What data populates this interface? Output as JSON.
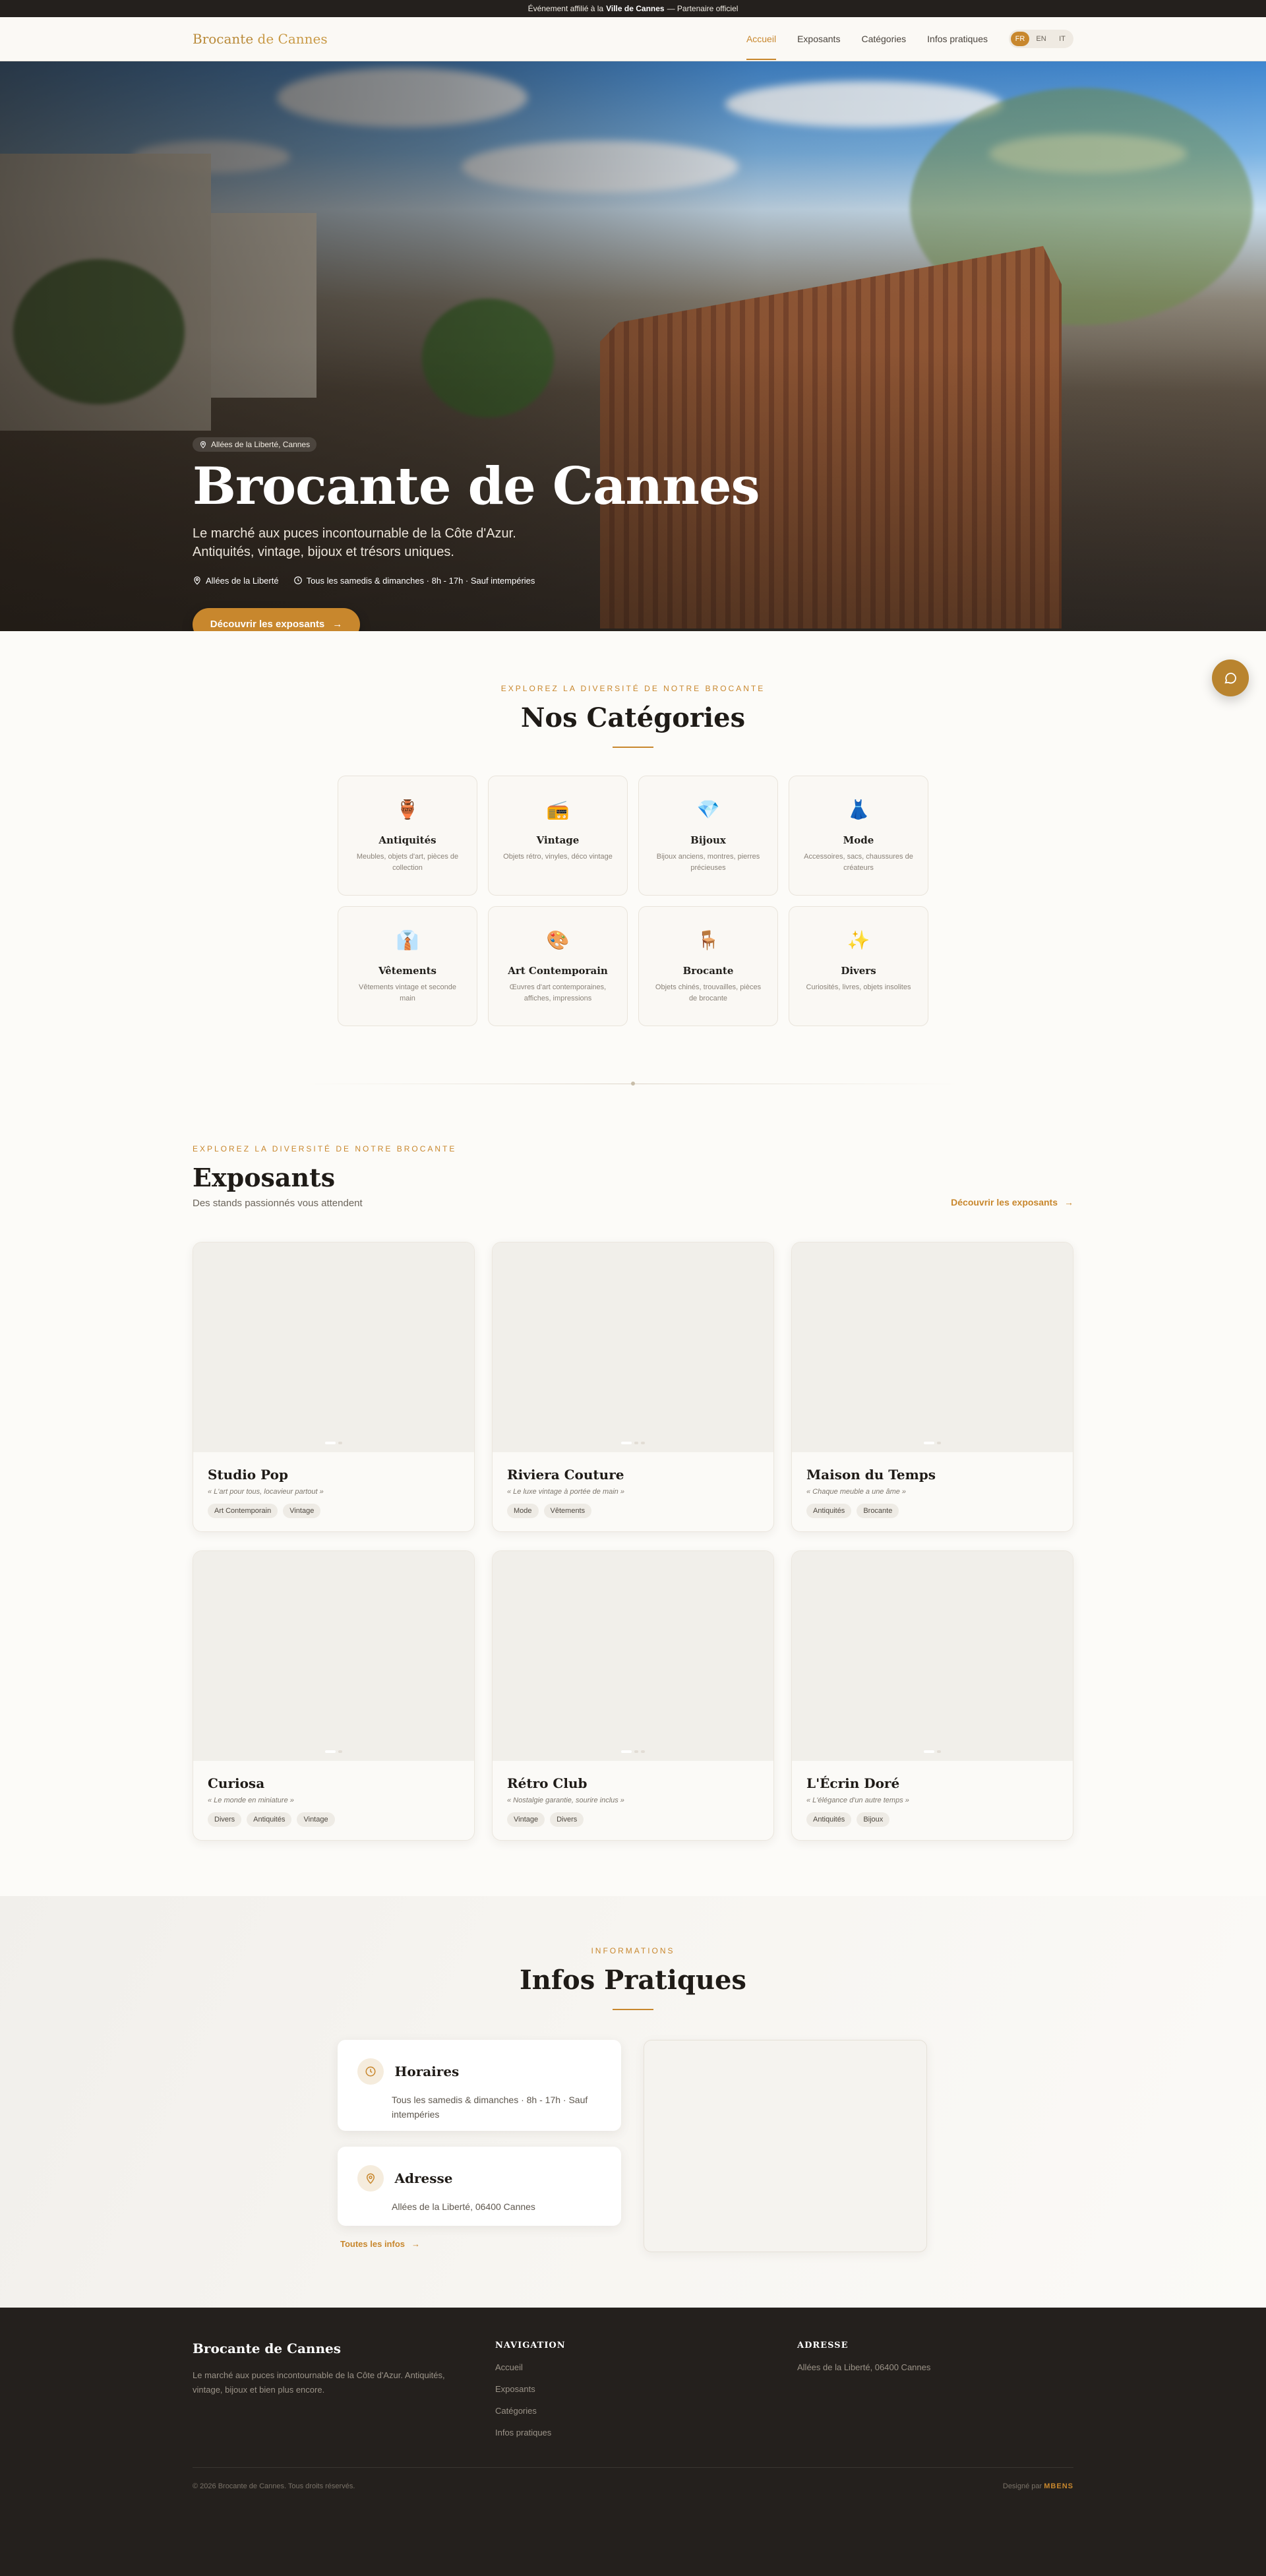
{
  "topbar": {
    "prefix": "Événement affilié à la",
    "city": "Ville de Cannes",
    "suffix": "— Partenaire officiel"
  },
  "brand": {
    "part1": "Brocante",
    "part2": "de Cannes"
  },
  "nav": {
    "items": [
      {
        "label": "Accueil",
        "active": true
      },
      {
        "label": "Exposants"
      },
      {
        "label": "Catégories"
      },
      {
        "label": "Infos pratiques"
      }
    ],
    "languages": [
      {
        "code": "FR",
        "selected": true
      },
      {
        "code": "EN"
      },
      {
        "code": "IT"
      }
    ]
  },
  "hero": {
    "badge": "Allées de la Liberté, Cannes",
    "title": "Brocante de Cannes",
    "subtitle_line1": "Le marché aux puces incontournable de la Côte d'Azur.",
    "subtitle_line2": "Antiquités, vintage, bijoux et trésors uniques.",
    "location": "Allées de la Liberté",
    "schedule": "Tous les samedis & dimanches · 8h - 17h · Sauf intempéries",
    "cta": "Découvrir les exposants"
  },
  "categories": {
    "kicker": "Explorez la diversité de notre brocante",
    "title": "Nos Catégories",
    "items": [
      {
        "icon": "🏺",
        "name": "Antiquités",
        "desc": "Meubles, objets d'art, pièces de collection"
      },
      {
        "icon": "📻",
        "name": "Vintage",
        "desc": "Objets rétro, vinyles, déco vintage"
      },
      {
        "icon": "💎",
        "name": "Bijoux",
        "desc": "Bijoux anciens, montres, pierres précieuses"
      },
      {
        "icon": "👗",
        "name": "Mode",
        "desc": "Accessoires, sacs, chaussures de créateurs"
      },
      {
        "icon": "👔",
        "name": "Vêtements",
        "desc": "Vêtements vintage et seconde main"
      },
      {
        "icon": "🎨",
        "name": "Art Contemporain",
        "desc": "Œuvres d'art contemporaines, affiches, impressions"
      },
      {
        "icon": "🪑",
        "name": "Brocante",
        "desc": "Objets chinés, trouvailles, pièces de brocante"
      },
      {
        "icon": "✨",
        "name": "Divers",
        "desc": "Curiosités, livres, objets insolites"
      }
    ]
  },
  "exposants": {
    "kicker": "Explorez la diversité de notre brocante",
    "title": "Exposants",
    "subtitle": "Des stands passionnés vous attendent",
    "link": "Découvrir les exposants",
    "items": [
      {
        "name": "Studio Pop",
        "tagline": "« L'art pour tous, locavieur partout »",
        "tags": [
          "Art Contemporain",
          "Vintage"
        ]
      },
      {
        "name": "Riviera Couture",
        "tagline": "« Le luxe vintage à portée de main »",
        "tags": [
          "Mode",
          "Vêtements"
        ]
      },
      {
        "name": "Maison du Temps",
        "tagline": "« Chaque meuble a une âme »",
        "tags": [
          "Antiquités",
          "Brocante"
        ]
      },
      {
        "name": "Curiosa",
        "tagline": "« Le monde en miniature »",
        "tags": [
          "Divers",
          "Antiquités",
          "Vintage"
        ]
      },
      {
        "name": "Rétro Club",
        "tagline": "« Nostalgie garantie, sourire inclus »",
        "tags": [
          "Vintage",
          "Divers"
        ]
      },
      {
        "name": "L'Écrin Doré",
        "tagline": "« L'élégance d'un autre temps »",
        "tags": [
          "Antiquités",
          "Bijoux"
        ]
      }
    ]
  },
  "infos": {
    "kicker": "Informations",
    "title": "Infos Pratiques",
    "horaires_title": "Horaires",
    "horaires_text": "Tous les samedis & dimanches · 8h - 17h · Sauf intempéries",
    "adresse_title": "Adresse",
    "adresse_text": "Allées de la Liberté, 06400 Cannes",
    "link": "Toutes les infos"
  },
  "footer": {
    "brand": "Brocante de Cannes",
    "about": "Le marché aux puces incontournable de la Côte d'Azur. Antiquités, vintage, bijoux et bien plus encore.",
    "nav_title": "Navigation",
    "nav_items": [
      "Accueil",
      "Exposants",
      "Catégories",
      "Infos pratiques"
    ],
    "address_title": "Adresse",
    "address": "Allées de la Liberté, 06400 Cannes",
    "copyright": "© 2026 Brocante de Cannes. Tous droits réservés.",
    "designed_by": "Designé par",
    "designer": "MBENS"
  },
  "colors": {
    "accent": "#c8872d",
    "dark": "#24201d",
    "background": "#fcfbf8"
  }
}
